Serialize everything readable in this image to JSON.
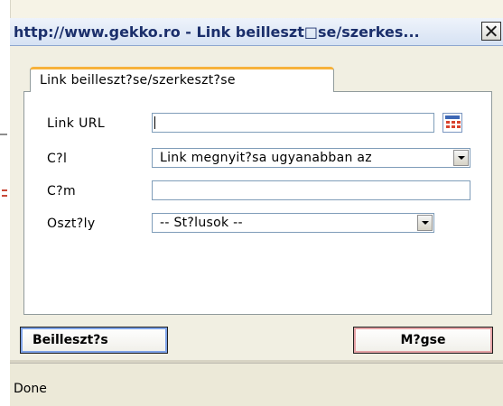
{
  "window": {
    "title": "http://www.gekko.ro - Link beilleszt□se/szerkes...",
    "close_icon": "close-icon"
  },
  "tab": {
    "label": "Link beilleszt?se/szerkeszt?se"
  },
  "form": {
    "url_label": "Link URL",
    "url_value": "",
    "url_picker_icon": "calendar-grid-icon",
    "target_label": "C?l",
    "target_selected": "Link megnyit?sa ugyanabban az",
    "title_label": "C?m",
    "title_value": "",
    "class_label": "Oszt?ly",
    "class_selected": "-- St?lusok --"
  },
  "buttons": {
    "insert_label": "Beilleszt?s",
    "cancel_label": "M?gse"
  },
  "status": {
    "text": "Done"
  },
  "colors": {
    "title_text": "#1b2f6b",
    "tab_accent": "#f7b23b",
    "insert_outline": "#7fa3e8",
    "cancel_outline": "#e6a3a6"
  }
}
